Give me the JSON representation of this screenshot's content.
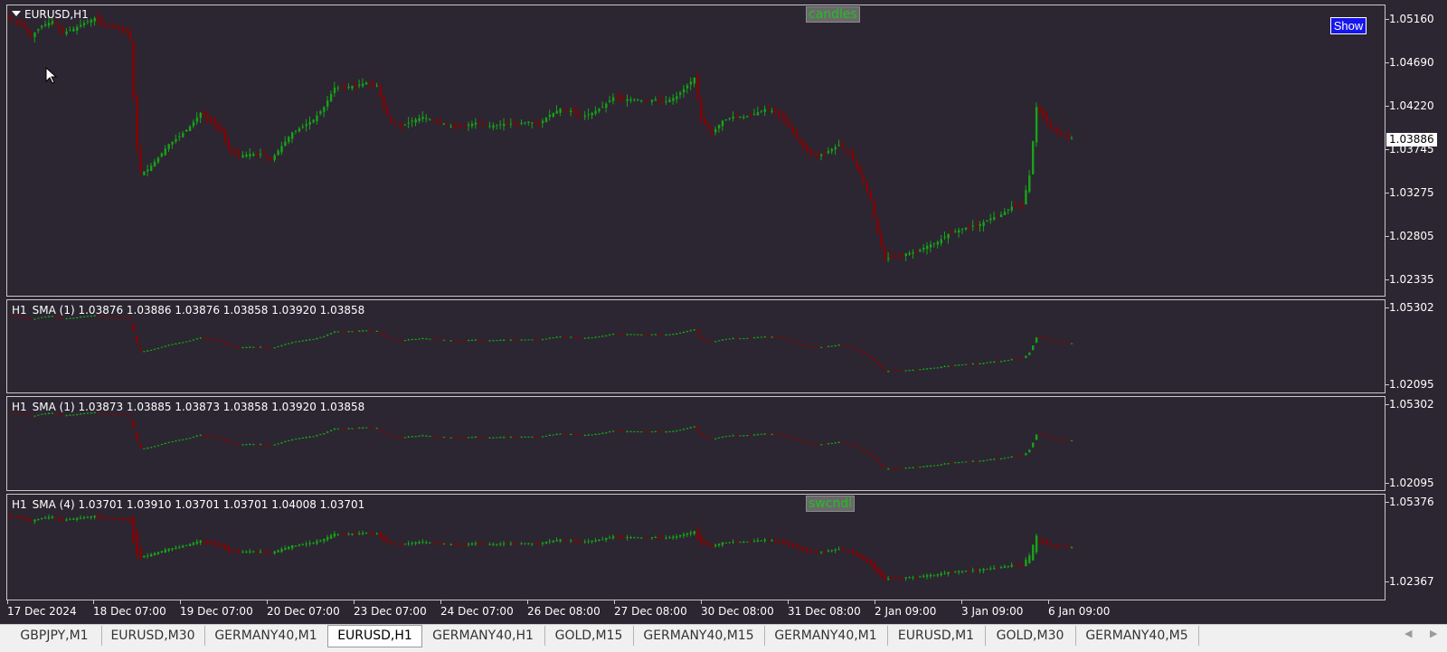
{
  "chart": {
    "symbol_title": "EURUSD,H1",
    "label_candles": "candles",
    "label_swcndl": "swcndl",
    "show_button": "Show",
    "current_price": "1.03886",
    "main_scale": [
      "1.05160",
      "1.04690",
      "1.04220",
      "1.03745",
      "1.03275",
      "1.02805",
      "1.02335"
    ],
    "sub1": {
      "legend": [
        "H1",
        "SMA (1) 1.03876 1.03886 1.03876 1.03858 1.03920 1.03858"
      ],
      "scale": [
        "1.05302",
        "1.02095"
      ]
    },
    "sub2": {
      "legend": [
        "H1",
        "SMA (1) 1.03873 1.03885 1.03873 1.03858 1.03920 1.03858"
      ],
      "scale": [
        "1.05302",
        "1.02095"
      ]
    },
    "sub3": {
      "legend": [
        "H1",
        "SMA (4) 1.03701 1.03910 1.03701 1.03701 1.04008 1.03701"
      ],
      "scale": [
        "1.05376",
        "1.02367"
      ]
    },
    "time_axis": [
      "17 Dec 2024",
      "18 Dec 07:00",
      "19 Dec 07:00",
      "20 Dec 07:00",
      "23 Dec 07:00",
      "24 Dec 07:00",
      "26 Dec 08:00",
      "27 Dec 08:00",
      "30 Dec 08:00",
      "31 Dec 08:00",
      "2 Jan 09:00",
      "3 Jan 09:00",
      "6 Jan 09:00"
    ],
    "colors": {
      "background": "#2b2631",
      "bull": "#17a317",
      "bear": "#8b0000",
      "text": "#ffffff",
      "button": "#1515ee"
    },
    "price_path": [
      [
        0,
        1.051
      ],
      [
        3,
        1.0505
      ],
      [
        6,
        1.0493
      ],
      [
        9,
        1.0503
      ],
      [
        12,
        1.0508
      ],
      [
        15,
        1.0496
      ],
      [
        18,
        1.05
      ],
      [
        21,
        1.0506
      ],
      [
        24,
        1.0511
      ],
      [
        27,
        1.0503
      ],
      [
        30,
        1.0501
      ],
      [
        33,
        1.0496
      ],
      [
        34,
        1.0489
      ],
      [
        35,
        1.043
      ],
      [
        36,
        1.0378
      ],
      [
        37,
        1.0352
      ],
      [
        39,
        1.0356
      ],
      [
        42,
        1.0368
      ],
      [
        45,
        1.0382
      ],
      [
        48,
        1.039
      ],
      [
        51,
        1.04
      ],
      [
        54,
        1.0414
      ],
      [
        57,
        1.0405
      ],
      [
        60,
        1.0394
      ],
      [
        62,
        1.0377
      ],
      [
        65,
        1.037
      ],
      [
        68,
        1.0372
      ],
      [
        71,
        1.0372
      ],
      [
        74,
        1.0366
      ],
      [
        77,
        1.038
      ],
      [
        80,
        1.0394
      ],
      [
        83,
        1.04
      ],
      [
        86,
        1.0407
      ],
      [
        89,
        1.042
      ],
      [
        92,
        1.044
      ],
      [
        95,
        1.044
      ],
      [
        98,
        1.0442
      ],
      [
        101,
        1.0445
      ],
      [
        104,
        1.0442
      ],
      [
        106,
        1.0418
      ],
      [
        108,
        1.0406
      ],
      [
        111,
        1.04
      ],
      [
        114,
        1.0406
      ],
      [
        117,
        1.041
      ],
      [
        120,
        1.0406
      ],
      [
        123,
        1.0403
      ],
      [
        126,
        1.0399
      ],
      [
        129,
        1.0401
      ],
      [
        132,
        1.0404
      ],
      [
        135,
        1.04
      ],
      [
        138,
        1.0402
      ],
      [
        141,
        1.0403
      ],
      [
        144,
        1.0403
      ],
      [
        147,
        1.0405
      ],
      [
        150,
        1.0403
      ],
      [
        153,
        1.0412
      ],
      [
        156,
        1.0418
      ],
      [
        159,
        1.0416
      ],
      [
        162,
        1.041
      ],
      [
        165,
        1.0414
      ],
      [
        168,
        1.042
      ],
      [
        171,
        1.043
      ],
      [
        174,
        1.0428
      ],
      [
        177,
        1.0428
      ],
      [
        180,
        1.0426
      ],
      [
        183,
        1.0428
      ],
      [
        186,
        1.0426
      ],
      [
        189,
        1.0431
      ],
      [
        192,
        1.0442
      ],
      [
        194,
        1.045
      ],
      [
        196,
        1.0406
      ],
      [
        199,
        1.0393
      ],
      [
        202,
        1.0406
      ],
      [
        205,
        1.041
      ],
      [
        208,
        1.041
      ],
      [
        211,
        1.0413
      ],
      [
        214,
        1.0418
      ],
      [
        217,
        1.0415
      ],
      [
        220,
        1.0405
      ],
      [
        223,
        1.0388
      ],
      [
        226,
        1.0374
      ],
      [
        229,
        1.037
      ],
      [
        232,
        1.0375
      ],
      [
        235,
        1.0381
      ],
      [
        238,
        1.0372
      ],
      [
        241,
        1.0352
      ],
      [
        244,
        1.0325
      ],
      [
        246,
        1.029
      ],
      [
        248,
        1.0265
      ],
      [
        251,
        1.0266
      ],
      [
        254,
        1.027
      ],
      [
        257,
        1.0272
      ],
      [
        260,
        1.0278
      ],
      [
        263,
        1.0282
      ],
      [
        266,
        1.029
      ],
      [
        269,
        1.0294
      ],
      [
        272,
        1.0298
      ],
      [
        275,
        1.03
      ],
      [
        278,
        1.0306
      ],
      [
        281,
        1.031
      ],
      [
        284,
        1.0318
      ],
      [
        287,
        1.032
      ],
      [
        289,
        1.035
      ],
      [
        291,
        1.042
      ],
      [
        293,
        1.041
      ],
      [
        295,
        1.04
      ],
      [
        298,
        1.0392
      ],
      [
        301,
        1.0388
      ]
    ]
  }
}
